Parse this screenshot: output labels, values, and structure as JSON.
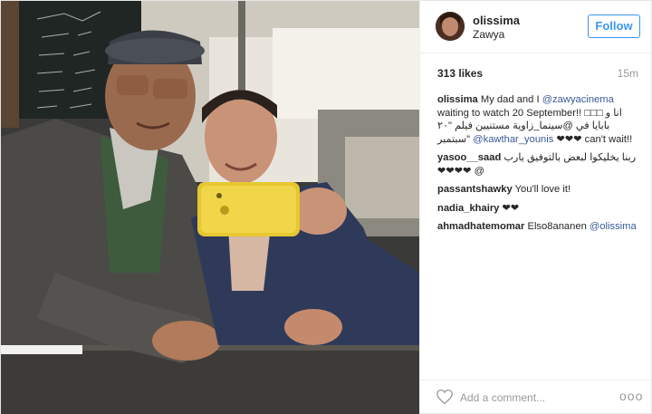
{
  "header": {
    "username": "olissima",
    "location": "Zawya",
    "follow_label": "Follow"
  },
  "meta": {
    "likes": "313 likes",
    "time_ago": "15m"
  },
  "caption": {
    "user": "olissima",
    "text1": "My dad and I ",
    "mention1": "@zawyacinema",
    "text2": " waiting to watch 20 September!! □□□ انا و بابايا في @سينما_زاوية مستنيين فيلم \"٢٠ سبتمبر\" ",
    "mention2": "@kawthar_younis",
    "text3": " ❤❤❤ can't wait!!"
  },
  "comments": [
    {
      "user": "yasoo__saad",
      "text": "ربنا يخليكوا لبعض بالتوفيق يارب ❤❤❤❤ @"
    },
    {
      "user": "passantshawky",
      "text": "You'll love it!"
    },
    {
      "user": "nadia_khairy",
      "text": "❤❤"
    },
    {
      "user": "ahmadhatemomar",
      "text": "Elso8ananen ",
      "mention": "@olissima"
    }
  ],
  "footer": {
    "add_comment_placeholder": "Add a comment...",
    "more_label": "ooo"
  },
  "icons": {
    "like": "heart-outline-icon",
    "more": "more-options-icon"
  },
  "colors": {
    "follow_blue": "#3897f0",
    "mention": "#3a5a99",
    "muted": "#999999"
  }
}
